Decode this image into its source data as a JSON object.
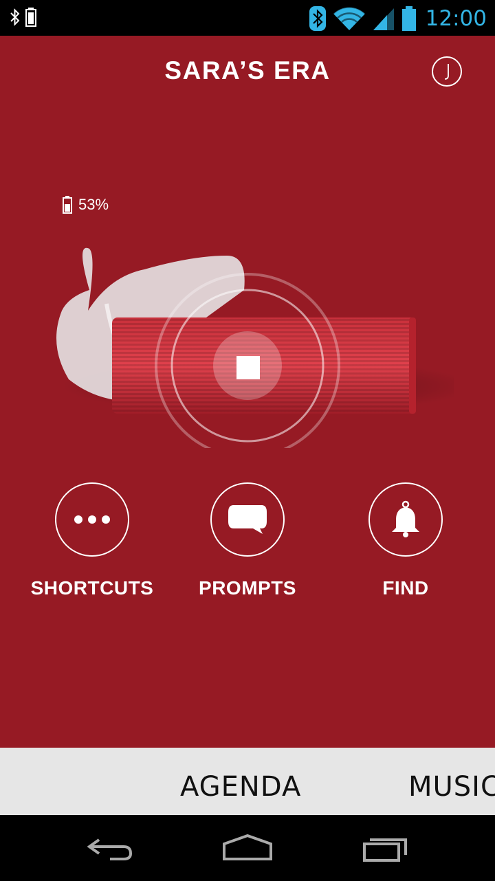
{
  "status_bar": {
    "time": "12:00",
    "icons": [
      "bluetooth-icon",
      "phone-battery-icon",
      "wifi-icon",
      "cell-signal-icon",
      "battery-icon"
    ]
  },
  "header": {
    "title": "SARA’S ERA",
    "logo": "jabra-logo"
  },
  "device": {
    "battery_level": "53%",
    "battery_fraction": 0.53,
    "record_button": "stop-icon"
  },
  "actions": [
    {
      "label": "SHORTCUTS",
      "icon": "more-dots-icon"
    },
    {
      "label": "PROMPTS",
      "icon": "speech-bubble-icon"
    },
    {
      "label": "FIND",
      "icon": "bell-icon"
    }
  ],
  "tabs": [
    {
      "label": "AGENDA"
    },
    {
      "label": "MUSIC"
    }
  ],
  "nav": [
    "back-icon",
    "home-icon",
    "recents-icon"
  ],
  "colors": {
    "background": "#961a24",
    "accent_blue": "#33b5e5",
    "tab_bar": "#e6e6e6"
  }
}
